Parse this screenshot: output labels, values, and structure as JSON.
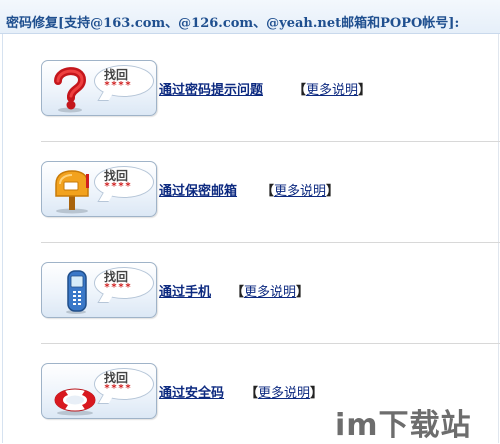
{
  "header": {
    "title": "密码修复[支持@163.com、@126.com、@yeah.net邮箱和POPO帐号]:"
  },
  "options": [
    {
      "icon": "question-mark-icon",
      "bubble_title": "找回",
      "bubble_stars": "****",
      "link": "通过密码提示问题",
      "more": "更多说明"
    },
    {
      "icon": "mailbox-icon",
      "bubble_title": "找回",
      "bubble_stars": "****",
      "link": "通过保密邮箱",
      "more": "更多说明"
    },
    {
      "icon": "mobile-phone-icon",
      "bubble_title": "找回",
      "bubble_stars": "****",
      "link": "通过手机",
      "more": "更多说明"
    },
    {
      "icon": "life-buoy-icon",
      "bubble_title": "找回",
      "bubble_stars": "****",
      "link": "通过安全码",
      "more": "更多说明"
    }
  ],
  "brackets": {
    "open": "【",
    "close": "】"
  },
  "watermark": {
    "text": "im下载站"
  },
  "colors": {
    "link": "#0d2a80",
    "header_text": "#1f4f8f",
    "stars": "#d02020"
  }
}
